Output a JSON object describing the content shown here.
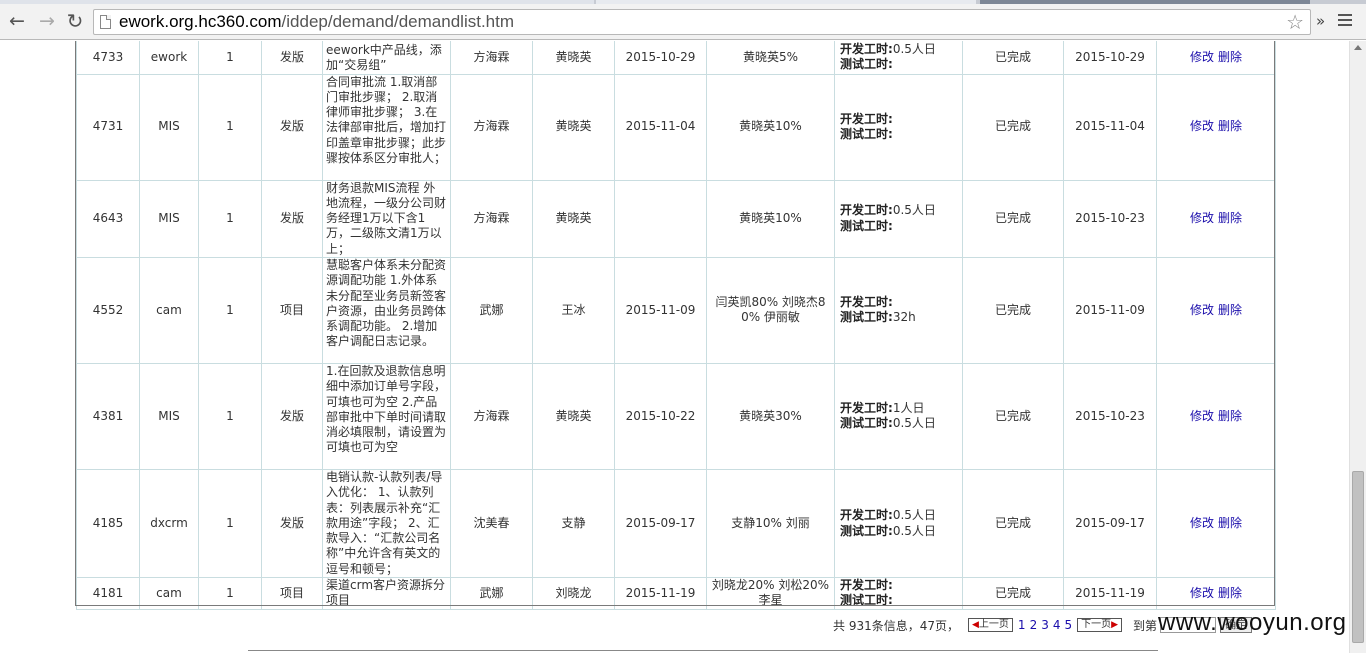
{
  "browser": {
    "url_host": "ework.org.hc360.com",
    "url_path": "/iddep/demand/demandlist.htm",
    "ext_chevron": "»"
  },
  "icons": {
    "back": "back-arrow-icon",
    "forward": "forward-arrow-icon",
    "reload": "reload-icon",
    "page": "page-icon",
    "star": "star-icon",
    "menu": "hamburger-menu-icon"
  },
  "table": {
    "dev_label": "开发工时:",
    "test_label": "测试工时:",
    "edit_label": "修改",
    "delete_label": "删除",
    "rows": [
      {
        "id": "4733",
        "system": "ework",
        "qty": "1",
        "type": "发版",
        "desc": "eework中产品线，添加“交易组”",
        "proposer": "方海霖",
        "owner": "黄晓英",
        "date": "2015-10-29",
        "assignees": "黄晓英5%",
        "dev": "0.5人日",
        "test": "",
        "status": "已完成",
        "done_date": "2015-10-29"
      },
      {
        "id": "4731",
        "system": "MIS",
        "qty": "1",
        "type": "发版",
        "desc": "合同审批流 1.取消部门审批步骤； 2.取消律师审批步骤； 3.在法律部审批后，增加打印盖章审批步骤；此步骤按体系区分审批人；",
        "proposer": "方海霖",
        "owner": "黄晓英",
        "date": "2015-11-04",
        "assignees": "黄晓英10%",
        "dev": "",
        "test": "",
        "status": "已完成",
        "done_date": "2015-11-04"
      },
      {
        "id": "4643",
        "system": "MIS",
        "qty": "1",
        "type": "发版",
        "desc": "财务退款MIS流程 外地流程，一级分公司财务经理1万以下含1万，二级陈文清1万以上；",
        "proposer": "方海霖",
        "owner": "黄晓英",
        "date": "",
        "assignees": "黄晓英10%",
        "dev": "0.5人日",
        "test": "",
        "status": "已完成",
        "done_date": "2015-10-23"
      },
      {
        "id": "4552",
        "system": "cam",
        "qty": "1",
        "type": "项目",
        "desc": "慧聪客户体系未分配资源调配功能 1.外体系未分配至业务员新签客户资源，由业务员跨体系调配功能。 2.增加客户调配日志记录。",
        "proposer": "武娜",
        "owner": "王冰",
        "date": "2015-11-09",
        "assignees": "闫英凯80% 刘晓杰80% 伊丽敏",
        "dev": "",
        "test": "32h",
        "status": "已完成",
        "done_date": "2015-11-09"
      },
      {
        "id": "4381",
        "system": "MIS",
        "qty": "1",
        "type": "发版",
        "desc": "1.在回款及退款信息明细中添加订单号字段，可填也可为空 2.产品部审批中下单时间请取消必填限制，请设置为可填也可为空",
        "proposer": "方海霖",
        "owner": "黄晓英",
        "date": "2015-10-22",
        "assignees": "黄晓英30%",
        "dev": "1人日",
        "test": "0.5人日",
        "status": "已完成",
        "done_date": "2015-10-23"
      },
      {
        "id": "4185",
        "system": "dxcrm",
        "qty": "1",
        "type": "发版",
        "desc": "电销认款-认款列表/导入优化： 1、认款列表：列表展示补充“汇款用途”字段； 2、汇款导入：“汇款公司名称”中允许含有英文的逗号和顿号；",
        "proposer": "沈美春",
        "owner": "支静",
        "date": "2015-09-17",
        "assignees": "支静10% 刘丽",
        "dev": "0.5人日",
        "test": "0.5人日",
        "status": "已完成",
        "done_date": "2015-09-17"
      },
      {
        "id": "4181",
        "system": "cam",
        "qty": "1",
        "type": "项目",
        "desc": "渠道crm客户资源拆分项目",
        "proposer": "武娜",
        "owner": "刘晓龙",
        "date": "2015-11-19",
        "assignees": "刘晓龙20% 刘松20% 李星",
        "dev": "",
        "test": "",
        "status": "已完成",
        "done_date": "2015-11-19"
      }
    ]
  },
  "pager": {
    "total": "共 931条信息，47页，",
    "prev": "上一页",
    "pages": [
      "1",
      "2",
      "3",
      "4",
      "5"
    ],
    "next": "下一页",
    "goto_label": "到第",
    "go_button": "确定"
  },
  "watermark": "www.wooyun.org"
}
